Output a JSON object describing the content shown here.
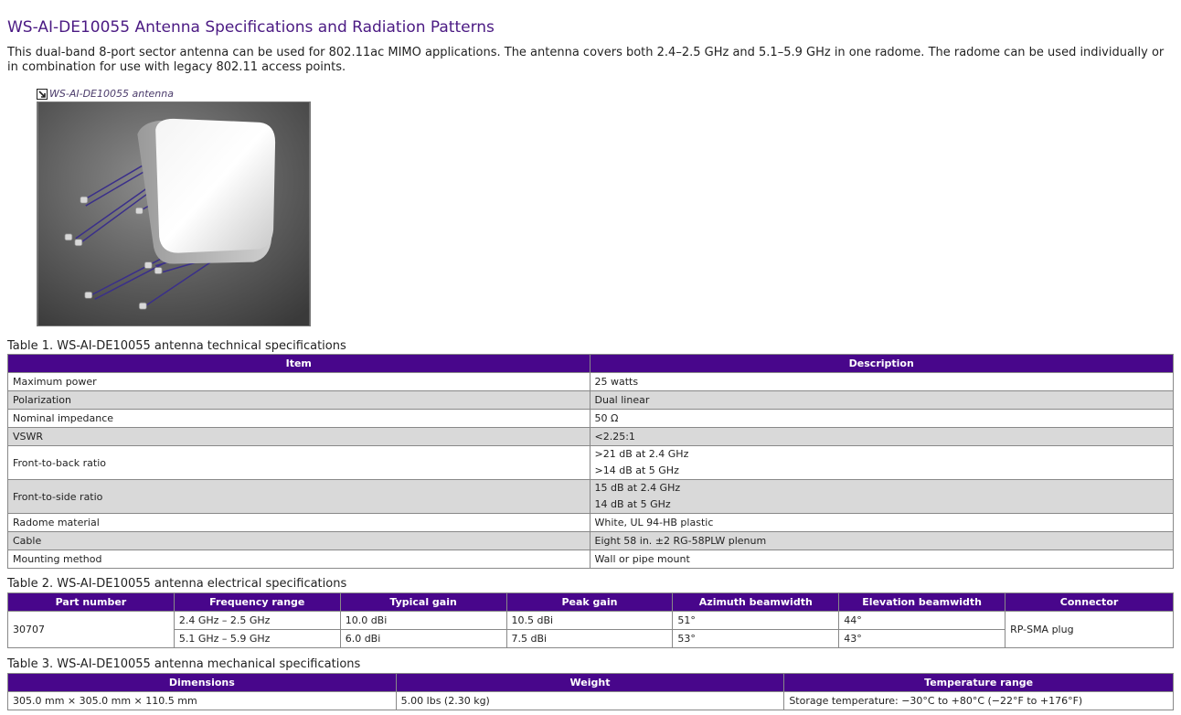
{
  "title": "WS-AI-DE10055 Antenna Specifications and Radiation Patterns",
  "intro": "This dual-band 8-port sector antenna can be used for 802.11ac MIMO applications. The antenna covers both 2.4–2.5 GHz and 5.1–5.9 GHz in one radome. The radome can be used individually or in combination for use with legacy 802.11 access points.",
  "figure": {
    "link_label": "WS-AI-DE10055 antenna"
  },
  "table1": {
    "caption": "Table 1. WS-AI-DE10055 antenna technical specifications",
    "headers": [
      "Item",
      "Description"
    ],
    "rows": [
      {
        "item": "Maximum power",
        "desc": [
          "25 watts"
        ]
      },
      {
        "item": "Polarization",
        "desc": [
          "Dual linear"
        ]
      },
      {
        "item": "Nominal impedance",
        "desc": [
          "50 Ω"
        ]
      },
      {
        "item": "VSWR",
        "desc": [
          "<2.25:1"
        ]
      },
      {
        "item": "Front-to-back ratio",
        "desc": [
          ">21 dB at 2.4 GHz",
          ">14 dB at 5 GHz"
        ]
      },
      {
        "item": "Front-to-side ratio",
        "desc": [
          "15 dB at 2.4 GHz",
          "14 dB at 5 GHz"
        ]
      },
      {
        "item": "Radome material",
        "desc": [
          "White, UL 94-HB plastic"
        ]
      },
      {
        "item": "Cable",
        "desc": [
          "Eight 58 in. ±2 RG-58PLW plenum"
        ]
      },
      {
        "item": "Mounting method",
        "desc": [
          "Wall or pipe mount"
        ]
      }
    ]
  },
  "table2": {
    "caption": "Table 2. WS-AI-DE10055 antenna electrical specifications",
    "headers": [
      "Part number",
      "Frequency range",
      "Typical gain",
      "Peak gain",
      "Azimuth beamwidth",
      "Elevation beamwidth",
      "Connector"
    ],
    "part_number": "30707",
    "connector": "RP-SMA plug",
    "rows": [
      {
        "freq": "2.4 GHz – 2.5 GHz",
        "typical": "10.0 dBi",
        "peak": "10.5 dBi",
        "azimuth": "51°",
        "elevation": "44°"
      },
      {
        "freq": "5.1 GHz – 5.9 GHz",
        "typical": "6.0 dBi",
        "peak": "7.5 dBi",
        "azimuth": "53°",
        "elevation": "43°"
      }
    ]
  },
  "table3": {
    "caption": "Table 3. WS-AI-DE10055 antenna mechanical specifications",
    "headers": [
      "Dimensions",
      "Weight",
      "Temperature range"
    ],
    "row": {
      "dimensions": "305.0 mm × 305.0 mm × 110.5 mm",
      "weight": "5.00 lbs (2.30 kg)",
      "temperature": "Storage temperature: −30°C to +80°C (−22°F to +176°F)"
    }
  },
  "colors": {
    "header_bg": "#48068b",
    "title": "#4b1a83",
    "alt_row": "#d9d9d9"
  },
  "icons": {
    "figure_link": "external-link-icon"
  }
}
